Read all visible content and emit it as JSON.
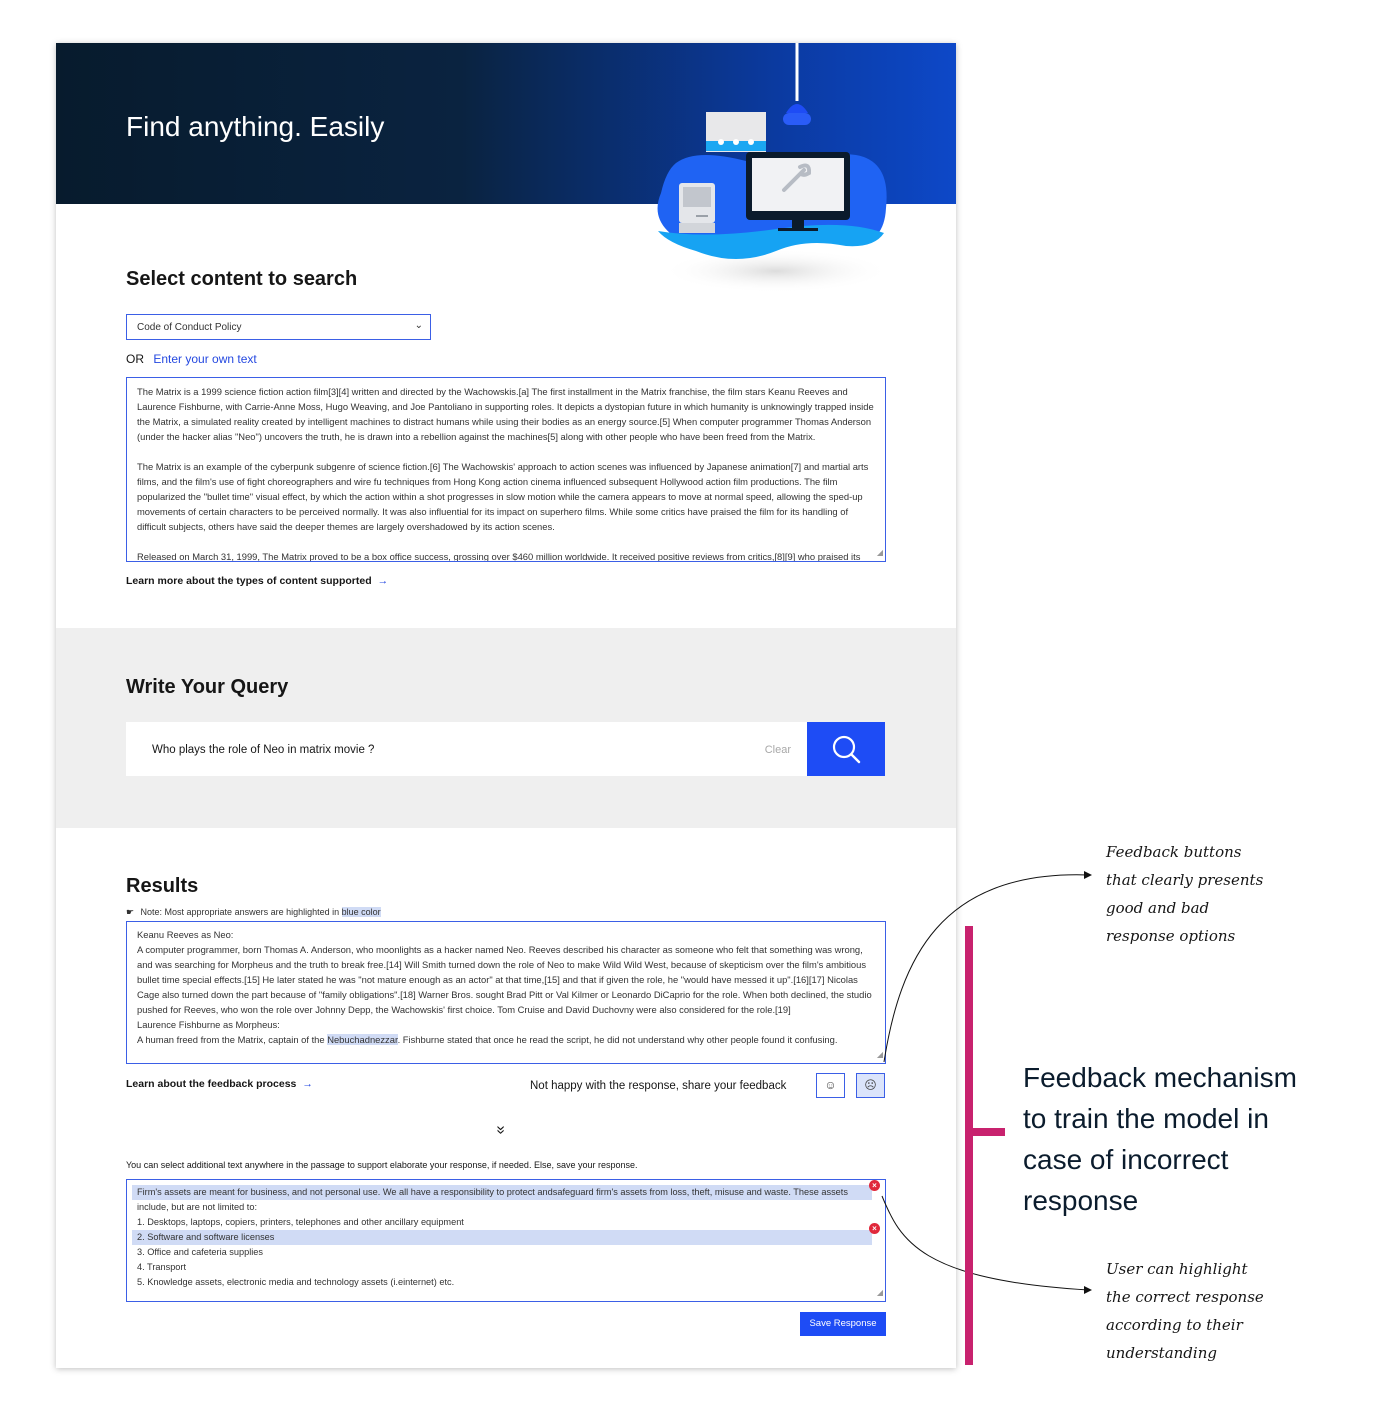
{
  "hero": {
    "title": "Find anything. Easily"
  },
  "content_section": {
    "title": "Select content to search",
    "select_value": "Code of Conduct Policy",
    "or_label": "OR",
    "own_text_link": "Enter your own text",
    "passage": [
      "The Matrix is a 1999 science fiction action film[3][4] written and directed by the Wachowskis.[a] The first installment in the Matrix franchise, the film stars Keanu Reeves and Laurence Fishburne, with Carrie-Anne Moss, Hugo Weaving, and Joe Pantoliano in supporting roles. It depicts a dystopian future in which humanity is unknowingly trapped inside the Matrix, a simulated reality created by intelligent machines to distract humans while using their bodies as an energy source.[5] When computer programmer Thomas Anderson (under the hacker alias \"Neo\") uncovers the truth, he is drawn into a rebellion against the machines[5] along with other people who have been freed from the Matrix.",
      "The Matrix is an example of the cyberpunk subgenre of science fiction.[6] The Wachowskis' approach to action scenes was influenced by Japanese animation[7] and martial arts films, and the film's use of fight choreographers and wire fu techniques from Hong Kong action cinema influenced subsequent Hollywood action film productions. The film popularized the \"bullet time\" visual effect, by which the action within a shot progresses in slow motion while the camera appears to move at normal speed, allowing the sped-up movements of certain characters to be perceived normally. It was also influential for its impact on superhero films. While some critics have praised the film for its handling of difficult subjects, others have said the deeper themes are largely overshadowed by its action scenes.",
      "Released on March 31, 1999, The Matrix proved to be a box office success, grossing over $460 million worldwide. It received positive reviews from critics,[8][9] who praised its"
    ],
    "learn_more": "Learn more about the types of content supported"
  },
  "query_section": {
    "title": "Write Your Query",
    "query_value": "Who plays the role of Neo in matrix movie ?",
    "clear_label": "Clear"
  },
  "results_section": {
    "title": "Results",
    "note_prefix": "Note: Most appropriate answers are highlighted in ",
    "note_highlight": "blue color",
    "lines": [
      "Keanu Reeves as Neo:",
      "A computer programmer, born Thomas A. Anderson, who moonlights as a hacker named Neo. Reeves described his character as someone who felt that something was wrong, and was searching for Morpheus and the truth to break free.[14] Will Smith turned down the role of Neo to make Wild Wild West, because of skepticism over the film's ambitious bullet time special effects.[15] He later stated he was \"not mature enough as an actor\" at that time,[15] and that if given the role, he \"would have messed it up\".[16][17] Nicolas Cage also turned down the part because of \"family obligations\".[18] Warner Bros. sought Brad Pitt or Val Kilmer or Leonardo DiCaprio for the role. When both declined, the studio pushed for Reeves, who won the role over Johnny Depp, the Wachowskis' first choice. Tom Cruise and David Duchovny were also considered for the role.[19]",
      "Laurence Fishburne as Morpheus:"
    ],
    "last_prefix": "A human freed from the Matrix, captain of the ",
    "last_highlight": "Nebuchadnezzar",
    "last_suffix": ". Fishburne stated that once he read the script, he did not understand why other people found it confusing.",
    "learn_feedback": "Learn about the feedback process",
    "feedback_prompt": "Not happy with the response, share your feedback",
    "happy_glyph": "☺",
    "sad_glyph": "☹",
    "instruction": "You can select additional text anywhere in the passage to support elaborate your response, if needed. Else, save your response.",
    "feedback_lines": [
      "Firm's assets are meant for business, and not personal use. We all have a responsibility to protect andsafeguard firm's assets from loss, theft, misuse and waste. These assets",
      "include, but are not limited to:",
      "1. Desktops, laptops, copiers, printers, telephones and other ancillary equipment",
      "2. Software and software licenses",
      "3. Office and cafeteria supplies",
      "4. Transport",
      "5. Knowledge assets, electronic media and technology assets (i.einternet) etc."
    ],
    "save_label": "Save Response"
  },
  "annotations": {
    "feedback_buttons": [
      "Feedback buttons",
      "that clearly presents",
      "good and bad",
      "response options"
    ],
    "mechanism": "Feedback mechanism to train the model in case of incorrect response",
    "highlight_note": [
      "User can highlight",
      "the correct response",
      "according to their",
      "understanding"
    ]
  },
  "colors": {
    "accent": "#1e4cf5",
    "annotation_bar": "#c8226e",
    "highlight": "#d0dbf5",
    "hero_dark": "#071b2d"
  }
}
